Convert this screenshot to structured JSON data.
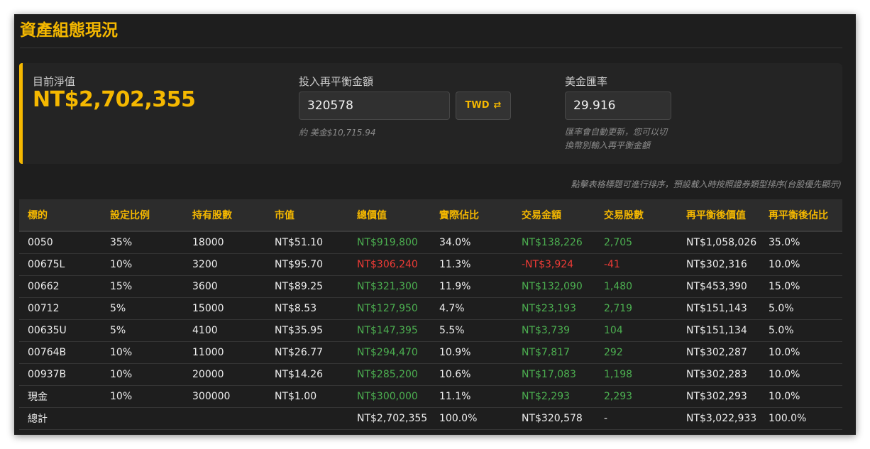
{
  "title": "資產組態現況",
  "summary": {
    "nav_label": "目前淨值",
    "nav_value": "NT$2,702,355",
    "invest_label": "投入再平衡金額",
    "invest_value": "320578",
    "currency_button": "TWD",
    "currency_button_icon": "swap-arrows-icon",
    "invest_usd": "約 美金$10,715.94",
    "fx_label": "美金匯率",
    "fx_value": "29.916",
    "fx_note_line1": "匯率會自動更新，您可以切",
    "fx_note_line2": "換幣別輸入再平衡金額"
  },
  "sort_hint": "點擊表格標題可進行排序，預設載入時按照證券類型排序(台股優先顯示)",
  "table": {
    "headers": [
      "標的",
      "設定比例",
      "持有股數",
      "市值",
      "總價值",
      "實際佔比",
      "交易金額",
      "交易股數",
      "再平衡後價值",
      "再平衡後佔比"
    ],
    "rows": [
      {
        "symbol": "0050",
        "target": "35%",
        "shares": "18000",
        "price": "NT$51.10",
        "value": "NT$919,800",
        "value_status": "pos",
        "actual": "34.0%",
        "trade_amount": "NT$138,226",
        "trade_status": "pos",
        "trade_shares": "2,705",
        "after_value": "NT$1,058,026",
        "after_pct": "35.0%"
      },
      {
        "symbol": "00675L",
        "target": "10%",
        "shares": "3200",
        "price": "NT$95.70",
        "value": "NT$306,240",
        "value_status": "neg",
        "actual": "11.3%",
        "trade_amount": "-NT$3,924",
        "trade_status": "neg",
        "trade_shares": "-41",
        "after_value": "NT$302,316",
        "after_pct": "10.0%"
      },
      {
        "symbol": "00662",
        "target": "15%",
        "shares": "3600",
        "price": "NT$89.25",
        "value": "NT$321,300",
        "value_status": "pos",
        "actual": "11.9%",
        "trade_amount": "NT$132,090",
        "trade_status": "pos",
        "trade_shares": "1,480",
        "after_value": "NT$453,390",
        "after_pct": "15.0%"
      },
      {
        "symbol": "00712",
        "target": "5%",
        "shares": "15000",
        "price": "NT$8.53",
        "value": "NT$127,950",
        "value_status": "pos",
        "actual": "4.7%",
        "trade_amount": "NT$23,193",
        "trade_status": "pos",
        "trade_shares": "2,719",
        "after_value": "NT$151,143",
        "after_pct": "5.0%"
      },
      {
        "symbol": "00635U",
        "target": "5%",
        "shares": "4100",
        "price": "NT$35.95",
        "value": "NT$147,395",
        "value_status": "pos",
        "actual": "5.5%",
        "trade_amount": "NT$3,739",
        "trade_status": "pos",
        "trade_shares": "104",
        "after_value": "NT$151,134",
        "after_pct": "5.0%"
      },
      {
        "symbol": "00764B",
        "target": "10%",
        "shares": "11000",
        "price": "NT$26.77",
        "value": "NT$294,470",
        "value_status": "pos",
        "actual": "10.9%",
        "trade_amount": "NT$7,817",
        "trade_status": "pos",
        "trade_shares": "292",
        "after_value": "NT$302,287",
        "after_pct": "10.0%"
      },
      {
        "symbol": "00937B",
        "target": "10%",
        "shares": "20000",
        "price": "NT$14.26",
        "value": "NT$285,200",
        "value_status": "pos",
        "actual": "10.6%",
        "trade_amount": "NT$17,083",
        "trade_status": "pos",
        "trade_shares": "1,198",
        "after_value": "NT$302,283",
        "after_pct": "10.0%"
      },
      {
        "symbol": "現金",
        "target": "10%",
        "shares": "300000",
        "price": "NT$1.00",
        "value": "NT$300,000",
        "value_status": "pos",
        "actual": "11.1%",
        "trade_amount": "NT$2,293",
        "trade_status": "pos",
        "trade_shares": "2,293",
        "after_value": "NT$302,293",
        "after_pct": "10.0%"
      }
    ],
    "total": {
      "label": "總計",
      "value": "NT$2,702,355",
      "actual": "100.0%",
      "trade_amount": "NT$320,578",
      "trade_shares": "-",
      "after_value": "NT$3,022,933",
      "after_pct": "100.0%"
    }
  },
  "colors": {
    "accent": "#f5b800",
    "positive": "#4caf50",
    "negative": "#ef3b36",
    "panel": "#1e1e1e"
  }
}
